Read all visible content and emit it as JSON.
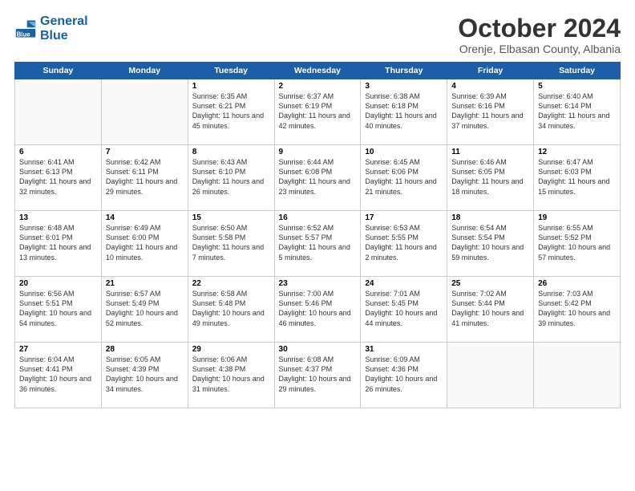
{
  "header": {
    "logo_line1": "General",
    "logo_line2": "Blue",
    "month": "October 2024",
    "location": "Orenje, Elbasan County, Albania"
  },
  "days_of_week": [
    "Sunday",
    "Monday",
    "Tuesday",
    "Wednesday",
    "Thursday",
    "Friday",
    "Saturday"
  ],
  "weeks": [
    [
      {
        "num": "",
        "info": ""
      },
      {
        "num": "",
        "info": ""
      },
      {
        "num": "1",
        "info": "Sunrise: 6:35 AM\nSunset: 6:21 PM\nDaylight: 11 hours and 45 minutes."
      },
      {
        "num": "2",
        "info": "Sunrise: 6:37 AM\nSunset: 6:19 PM\nDaylight: 11 hours and 42 minutes."
      },
      {
        "num": "3",
        "info": "Sunrise: 6:38 AM\nSunset: 6:18 PM\nDaylight: 11 hours and 40 minutes."
      },
      {
        "num": "4",
        "info": "Sunrise: 6:39 AM\nSunset: 6:16 PM\nDaylight: 11 hours and 37 minutes."
      },
      {
        "num": "5",
        "info": "Sunrise: 6:40 AM\nSunset: 6:14 PM\nDaylight: 11 hours and 34 minutes."
      }
    ],
    [
      {
        "num": "6",
        "info": "Sunrise: 6:41 AM\nSunset: 6:13 PM\nDaylight: 11 hours and 32 minutes."
      },
      {
        "num": "7",
        "info": "Sunrise: 6:42 AM\nSunset: 6:11 PM\nDaylight: 11 hours and 29 minutes."
      },
      {
        "num": "8",
        "info": "Sunrise: 6:43 AM\nSunset: 6:10 PM\nDaylight: 11 hours and 26 minutes."
      },
      {
        "num": "9",
        "info": "Sunrise: 6:44 AM\nSunset: 6:08 PM\nDaylight: 11 hours and 23 minutes."
      },
      {
        "num": "10",
        "info": "Sunrise: 6:45 AM\nSunset: 6:06 PM\nDaylight: 11 hours and 21 minutes."
      },
      {
        "num": "11",
        "info": "Sunrise: 6:46 AM\nSunset: 6:05 PM\nDaylight: 11 hours and 18 minutes."
      },
      {
        "num": "12",
        "info": "Sunrise: 6:47 AM\nSunset: 6:03 PM\nDaylight: 11 hours and 15 minutes."
      }
    ],
    [
      {
        "num": "13",
        "info": "Sunrise: 6:48 AM\nSunset: 6:01 PM\nDaylight: 11 hours and 13 minutes."
      },
      {
        "num": "14",
        "info": "Sunrise: 6:49 AM\nSunset: 6:00 PM\nDaylight: 11 hours and 10 minutes."
      },
      {
        "num": "15",
        "info": "Sunrise: 6:50 AM\nSunset: 5:58 PM\nDaylight: 11 hours and 7 minutes."
      },
      {
        "num": "16",
        "info": "Sunrise: 6:52 AM\nSunset: 5:57 PM\nDaylight: 11 hours and 5 minutes."
      },
      {
        "num": "17",
        "info": "Sunrise: 6:53 AM\nSunset: 5:55 PM\nDaylight: 11 hours and 2 minutes."
      },
      {
        "num": "18",
        "info": "Sunrise: 6:54 AM\nSunset: 5:54 PM\nDaylight: 10 hours and 59 minutes."
      },
      {
        "num": "19",
        "info": "Sunrise: 6:55 AM\nSunset: 5:52 PM\nDaylight: 10 hours and 57 minutes."
      }
    ],
    [
      {
        "num": "20",
        "info": "Sunrise: 6:56 AM\nSunset: 5:51 PM\nDaylight: 10 hours and 54 minutes."
      },
      {
        "num": "21",
        "info": "Sunrise: 6:57 AM\nSunset: 5:49 PM\nDaylight: 10 hours and 52 minutes."
      },
      {
        "num": "22",
        "info": "Sunrise: 6:58 AM\nSunset: 5:48 PM\nDaylight: 10 hours and 49 minutes."
      },
      {
        "num": "23",
        "info": "Sunrise: 7:00 AM\nSunset: 5:46 PM\nDaylight: 10 hours and 46 minutes."
      },
      {
        "num": "24",
        "info": "Sunrise: 7:01 AM\nSunset: 5:45 PM\nDaylight: 10 hours and 44 minutes."
      },
      {
        "num": "25",
        "info": "Sunrise: 7:02 AM\nSunset: 5:44 PM\nDaylight: 10 hours and 41 minutes."
      },
      {
        "num": "26",
        "info": "Sunrise: 7:03 AM\nSunset: 5:42 PM\nDaylight: 10 hours and 39 minutes."
      }
    ],
    [
      {
        "num": "27",
        "info": "Sunrise: 6:04 AM\nSunset: 4:41 PM\nDaylight: 10 hours and 36 minutes."
      },
      {
        "num": "28",
        "info": "Sunrise: 6:05 AM\nSunset: 4:39 PM\nDaylight: 10 hours and 34 minutes."
      },
      {
        "num": "29",
        "info": "Sunrise: 6:06 AM\nSunset: 4:38 PM\nDaylight: 10 hours and 31 minutes."
      },
      {
        "num": "30",
        "info": "Sunrise: 6:08 AM\nSunset: 4:37 PM\nDaylight: 10 hours and 29 minutes."
      },
      {
        "num": "31",
        "info": "Sunrise: 6:09 AM\nSunset: 4:36 PM\nDaylight: 10 hours and 26 minutes."
      },
      {
        "num": "",
        "info": ""
      },
      {
        "num": "",
        "info": ""
      }
    ]
  ]
}
